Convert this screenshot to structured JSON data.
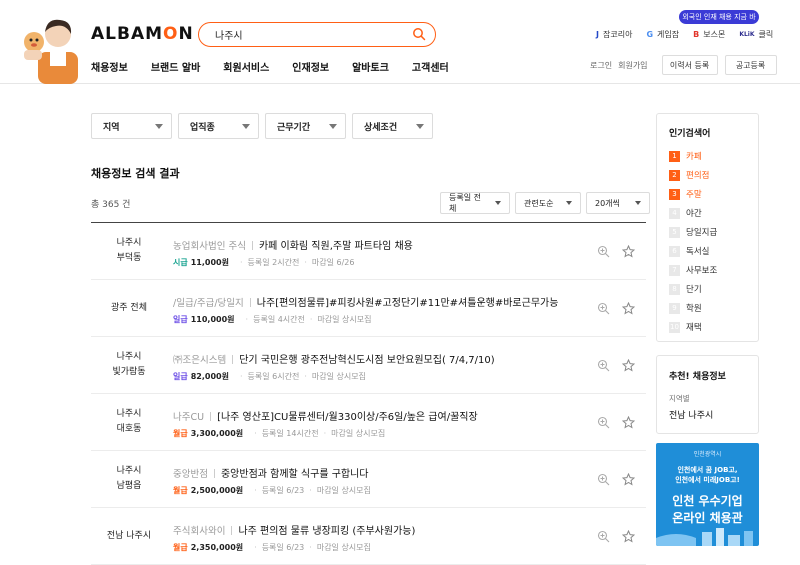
{
  "header": {
    "logo": {
      "pre": "ALBAM",
      "o": "O",
      "post": "N"
    },
    "search": {
      "value": "나주시"
    },
    "promo_badge": "외국인 인재 채용 지금 바로!",
    "family_sites": [
      {
        "mark": "J",
        "label": "잡코리아",
        "color": "#2348c7"
      },
      {
        "mark": "G",
        "label": "게임잡",
        "color": "#4a8df0"
      },
      {
        "mark": "B",
        "label": "보스몬",
        "color": "#e2362b"
      },
      {
        "mark": "KLiK",
        "label": "클릭",
        "color": "#2f2f8f"
      }
    ],
    "nav": [
      "채용정보",
      "브랜드 알바",
      "회원서비스",
      "인재정보",
      "알바토크",
      "고객센터"
    ],
    "login": "로그인",
    "signup": "회원가입",
    "resume_button": "이력서 등록",
    "post_button": "공고등록"
  },
  "filters": [
    "지역",
    "업직종",
    "근무기간",
    "상세조건"
  ],
  "results": {
    "title": "채용정보 검색 결과",
    "total": "총 365 건",
    "sorts": [
      "등록일 전체",
      "관련도순",
      "20개씩"
    ]
  },
  "jobs": [
    {
      "loc1": "나주시",
      "loc2": "부덕동",
      "company": "농업회사법인 주식",
      "title": "카페 이화림 직원,주말 파트타임 채용",
      "pay_type": "시급",
      "pay_class": "hourly",
      "amount": "11,000원",
      "posted": "등록일 2시간전",
      "deadline": "마감일 6/26"
    },
    {
      "loc1": "광주 전체",
      "loc2": "",
      "company": "/일급/주급/당일지",
      "title": "나주[편의점물류]#피킹사원#고정단기#11만#셔틀운행#바로근무가능",
      "pay_type": "일급",
      "pay_class": "daily",
      "amount": "110,000원",
      "posted": "등록일 4시간전",
      "deadline": "마감일 상시모집"
    },
    {
      "loc1": "나주시",
      "loc2": "빛가람동",
      "company": "㈜조은시스템",
      "title": "단기 국민은행 광주전남혁신도시점 보안요원모집( 7/4,7/10)",
      "pay_type": "일급",
      "pay_class": "daily",
      "amount": "82,000원",
      "posted": "등록일 6시간전",
      "deadline": "마감일 상시모집"
    },
    {
      "loc1": "나주시",
      "loc2": "대호동",
      "company": "나주CU",
      "title": "[나주 영산포]CU물류센터/월330이상/주6일/높은 급여/꿀직장",
      "pay_type": "월급",
      "pay_class": "monthly",
      "amount": "3,300,000원",
      "posted": "등록일 14시간전",
      "deadline": "마감일 상시모집"
    },
    {
      "loc1": "나주시",
      "loc2": "남평읍",
      "company": "중앙반점",
      "title": "중앙반점과 함께할 식구를 구합니다",
      "pay_type": "월급",
      "pay_class": "monthly",
      "amount": "2,500,000원",
      "posted": "등록일 6/23",
      "deadline": "마감일 상시모집"
    },
    {
      "loc1": "전남 나주시",
      "loc2": "",
      "company": "주식회사와이",
      "title": "나주 편의점 물류 냉장피킹 (주부사원가능)",
      "pay_type": "월급",
      "pay_class": "monthly",
      "amount": "2,350,000원",
      "posted": "등록일 6/23",
      "deadline": "마감일 상시모집"
    }
  ],
  "popular": {
    "title": "인기검색어",
    "items": [
      "카페",
      "편의점",
      "주말",
      "야간",
      "당일지급",
      "독서실",
      "사무보조",
      "단기",
      "학원",
      "재택"
    ]
  },
  "recommend": {
    "title": "추천! 채용정보",
    "label": "지역별",
    "value": "전남 나주시"
  },
  "banner": {
    "org": "인천광역시",
    "line1": "인천에서 꿈 JOB고,",
    "line2": "인천에서 미래JOB고!",
    "big1": "인천 우수기업",
    "big2": "온라인 채용관"
  },
  "colors": {
    "accent": "#ff5f15",
    "hourly": "#16a28f",
    "daily": "#6b4de6",
    "monthly": "#ff5f15",
    "banner": "#1f8ed8"
  }
}
